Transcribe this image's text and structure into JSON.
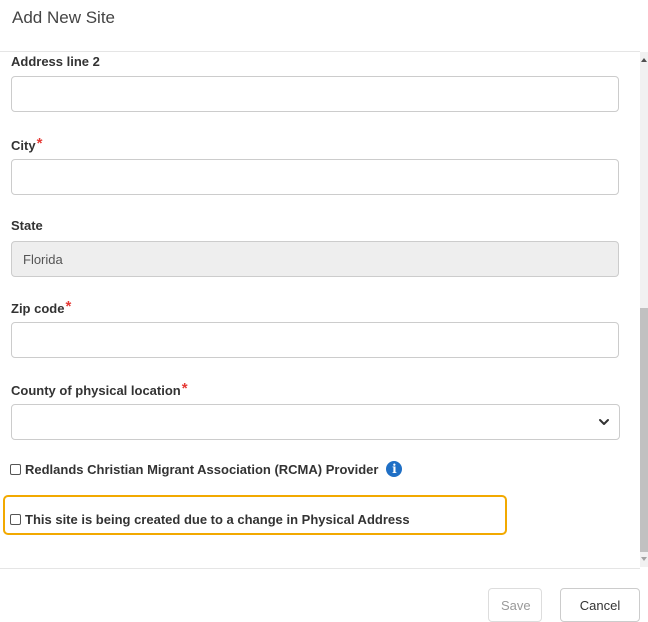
{
  "modal": {
    "title": "Add New Site"
  },
  "fields": {
    "address_line2": {
      "label": "Address line 2",
      "value": ""
    },
    "city": {
      "label": "City",
      "required_mark": "*",
      "value": ""
    },
    "state": {
      "label": "State",
      "value": "Florida"
    },
    "zip": {
      "label": "Zip code",
      "required_mark": "*",
      "value": ""
    },
    "county": {
      "label": "County of physical location",
      "required_mark": "*",
      "selected": ""
    }
  },
  "checkboxes": {
    "rcma": {
      "label": "Redlands Christian Migrant Association (RCMA) Provider",
      "checked": false,
      "info_icon": "info-circle-icon"
    },
    "address_change": {
      "label": "This site is being created due to a change in Physical Address",
      "checked": false
    }
  },
  "footer": {
    "save_label": "Save",
    "cancel_label": "Cancel"
  },
  "colors": {
    "required": "#e53935",
    "highlight": "#f2a900",
    "info": "#1f6fc5"
  }
}
